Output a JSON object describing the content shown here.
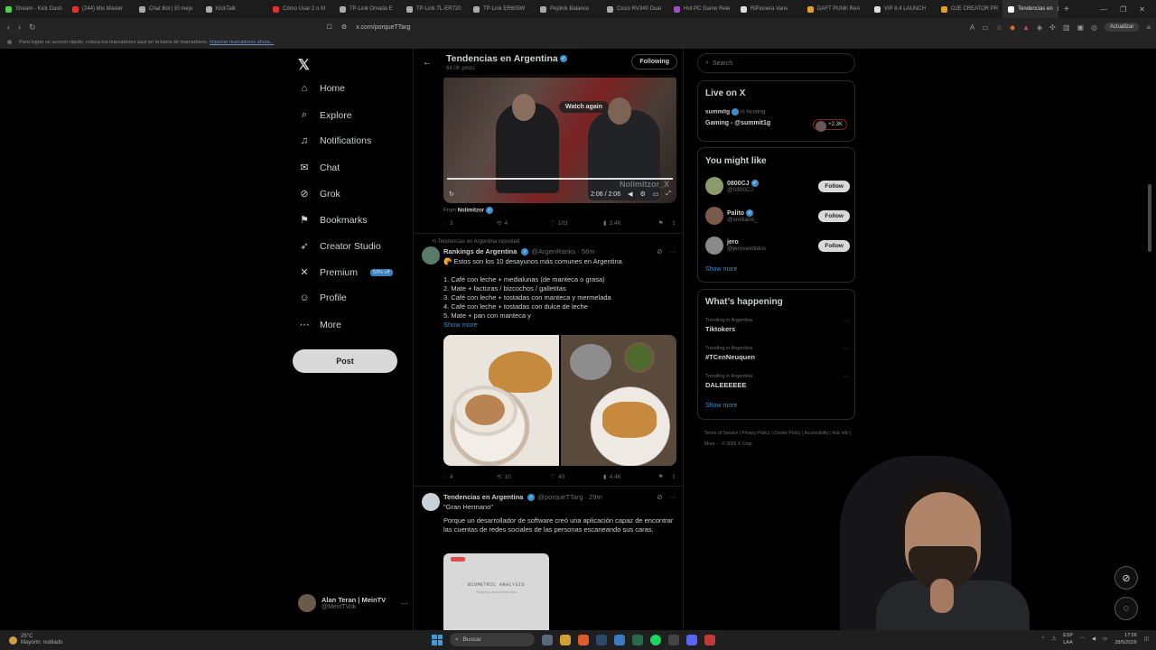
{
  "browser": {
    "tabs": [
      {
        "label": "Stream - Kick Dash",
        "color": "#4fd04f"
      },
      {
        "label": "(244) Mix Master",
        "color": "#e03030"
      },
      {
        "label": "Chat Bot | El mejo",
        "color": "#aaaaaa"
      },
      {
        "label": "KickTalk",
        "color": "#aaaaaa"
      },
      {
        "label": "Cómo Usar 2 o M",
        "color": "#e03030"
      },
      {
        "label": "TP-Link Omada E",
        "color": "#aaaaaa"
      },
      {
        "label": "TP-Link TL-ER720",
        "color": "#aaaaaa"
      },
      {
        "label": "TP-Link ER605W",
        "color": "#aaaaaa"
      },
      {
        "label": "Peplink Balance",
        "color": "#aaaaaa"
      },
      {
        "label": "Cisco RV340 Dual",
        "color": "#aaaaaa"
      },
      {
        "label": "Hot PC Game Rele",
        "color": "#a050c0"
      },
      {
        "label": "RiPionera Vans",
        "color": "#dddddd"
      },
      {
        "label": "DAFT PUNK ReA",
        "color": "#e0a030"
      },
      {
        "label": "VIP 8.4 LAUNCH",
        "color": "#dddddd"
      },
      {
        "label": "OJE CREATOR PR",
        "color": "#e0a030"
      }
    ],
    "active_tab": "Tendencias en",
    "url": "x.com/porqueTTarg",
    "update_label": "Actualizar",
    "bookmarks_hint": "Para lograr un acceso rápido, coloca tus marcadores aquí en la barra de marcadores.",
    "bookmarks_link": "Importar marcadores ahora..."
  },
  "nav": {
    "items": [
      {
        "label": "Home",
        "icon": "⌂"
      },
      {
        "label": "Explore",
        "icon": "⌕"
      },
      {
        "label": "Notifications",
        "icon": "♫"
      },
      {
        "label": "Chat",
        "icon": "✉"
      },
      {
        "label": "Grok",
        "icon": "⊘"
      },
      {
        "label": "Bookmarks",
        "icon": "⚑"
      },
      {
        "label": "Creator Studio",
        "icon": "➶"
      },
      {
        "label": "Premium",
        "icon": "✕"
      },
      {
        "label": "Profile",
        "icon": "☺"
      },
      {
        "label": "More",
        "icon": "⋯"
      }
    ],
    "premium_badge": "50% off",
    "post_label": "Post",
    "account": {
      "name": "Alan Teran | MeinTV",
      "handle": "@MeinTVok"
    }
  },
  "header": {
    "title": "Tendencias en Argentina",
    "posts": "64.0K posts",
    "following_label": "Following"
  },
  "video_post": {
    "watch_again": "Watch again",
    "time": "2:06 / 2:06",
    "watermark": "Nolimitzor_X",
    "from_prefix": "From",
    "from_name": "Nolimitzor",
    "stats": {
      "replies": "3",
      "reposts": "4",
      "likes": "103",
      "views": "3.4K"
    }
  },
  "post2": {
    "repost_note": "Tendencias en Argentina reposted",
    "author": "Rankings de Argentina",
    "handle": "@ArgenRanks · 56m",
    "lines": [
      "🥐 Estos son los 10 desayunos más comunes en Argentina",
      "1. Café con leche + medialunas (de manteca o grasa)",
      "2. Mate + facturas / bizcochos / galletitas",
      "3. Café con leche + tostadas con manteca y mermelada",
      "4. Café con leche + tostadas con dulce de leche",
      "5. Mate + pan con manteca y"
    ],
    "show_more": "Show more",
    "stats": {
      "replies": "4",
      "reposts": "10",
      "likes": "40",
      "views": "4.4K"
    }
  },
  "post3": {
    "author": "Tendencias en Argentina",
    "handle": "@porqueTTarg · 29m",
    "quote": "\"Gran Hermano\"",
    "body": "Porque un desarrollador de software creó una aplicación capaz de encontrar las cuentas de redes sociales de las personas escaneando sus caras.",
    "phone_label": "BIOMETRIC ANALYSIS",
    "phone_sub": "Mapping anatomical data"
  },
  "right": {
    "search_placeholder": "Search",
    "live": {
      "title": "Live on X",
      "host": "summitg",
      "hosting": "is hosting",
      "topic": "Gaming - @summit1g",
      "count": "+2.3K"
    },
    "might_like": {
      "title": "You might like",
      "users": [
        {
          "name": "0800CJ",
          "handle": "@0800CJ",
          "color": "#8a9a6a"
        },
        {
          "name": "Palito",
          "handle": "@xmilianx_",
          "color": "#7a5a4a"
        },
        {
          "name": "jero",
          "handle": "@jeroveintidos",
          "color": "#8a8a8a"
        }
      ],
      "follow_label": "Follow",
      "show_more": "Show more"
    },
    "happening": {
      "title": "What’s happening",
      "trends": [
        {
          "context": "Trending in Argentina",
          "topic": "Tiktokers"
        },
        {
          "context": "Trending in Argentina",
          "topic": "#TCenNeuquen"
        },
        {
          "context": "Trending in Argentina",
          "topic": "DALEEEEEE"
        }
      ],
      "show_more": "Show more"
    },
    "footer": "Terms of Service  |  Privacy Policy  |  Cookie Policy  |  Accessibility  |  Ads info  |  More ···  © 2026 X Corp."
  },
  "taskbar": {
    "temp": "25°C",
    "weather": "Mayorm. nublado",
    "search": "Buscar",
    "lang1": "ESP",
    "lang2": "LAA",
    "time": "17:56",
    "date": "28/5/2026"
  }
}
